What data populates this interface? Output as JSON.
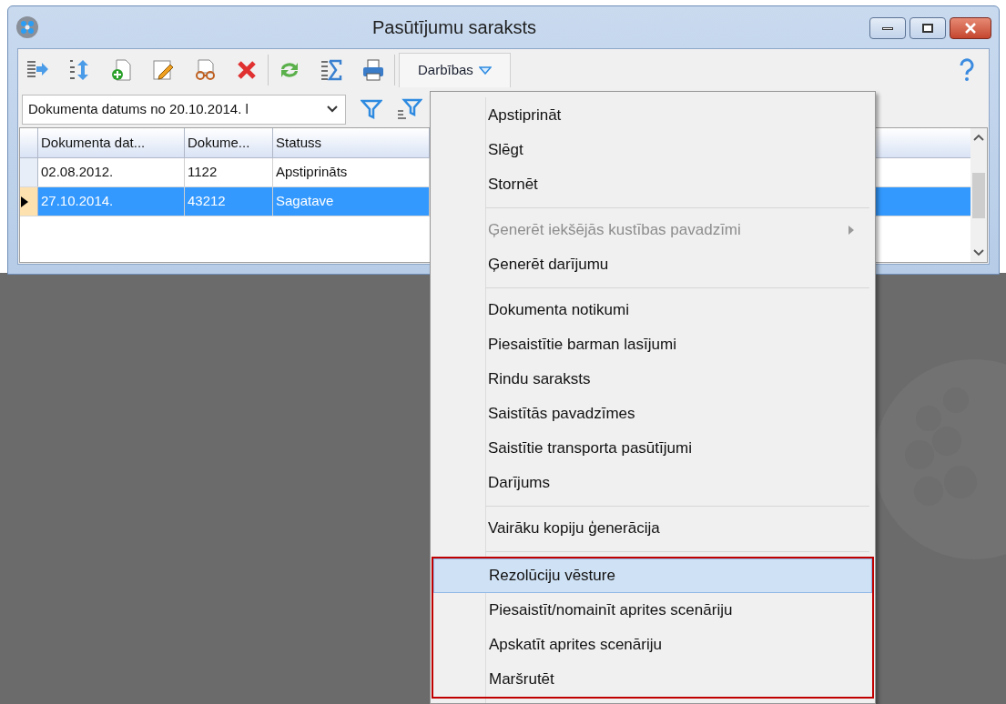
{
  "window": {
    "title": "Pasūtījumu saraksts"
  },
  "toolbar": {
    "actions_button": {
      "label": "Darbības",
      "expanded": true
    }
  },
  "filter": {
    "value": "Dokumenta datums no 20.10.2014. l"
  },
  "table": {
    "columns": [
      "Dokumenta dat...",
      "Dokume...",
      "Statuss"
    ],
    "rows": [
      {
        "cells": [
          "02.08.2012.",
          "1122",
          "Apstiprināts"
        ],
        "selected": false
      },
      {
        "cells": [
          "27.10.2014.",
          "43212",
          "Sagatave"
        ],
        "selected": true
      }
    ]
  },
  "menu": {
    "items": [
      {
        "kind": "item",
        "label": "Apstiprināt",
        "disabled": false,
        "selected": false,
        "submenu": false,
        "outlined": false
      },
      {
        "kind": "item",
        "label": "Slēgt",
        "disabled": false,
        "selected": false,
        "submenu": false,
        "outlined": false
      },
      {
        "kind": "item",
        "label": "Stornēt",
        "disabled": false,
        "selected": false,
        "submenu": false,
        "outlined": false
      },
      {
        "kind": "separator"
      },
      {
        "kind": "item",
        "label": "Ģenerēt iekšējās kustības pavadzīmi",
        "disabled": true,
        "selected": false,
        "submenu": true,
        "outlined": false
      },
      {
        "kind": "item",
        "label": "Ģenerēt darījumu",
        "disabled": false,
        "selected": false,
        "submenu": false,
        "outlined": false
      },
      {
        "kind": "separator"
      },
      {
        "kind": "item",
        "label": "Dokumenta notikumi",
        "disabled": false,
        "selected": false,
        "submenu": false,
        "outlined": false
      },
      {
        "kind": "item",
        "label": "Piesaistītie barman lasījumi",
        "disabled": false,
        "selected": false,
        "submenu": false,
        "outlined": false
      },
      {
        "kind": "item",
        "label": "Rindu saraksts",
        "disabled": false,
        "selected": false,
        "submenu": false,
        "outlined": false
      },
      {
        "kind": "item",
        "label": "Saistītās pavadzīmes",
        "disabled": false,
        "selected": false,
        "submenu": false,
        "outlined": false
      },
      {
        "kind": "item",
        "label": "Saistītie transporta pasūtījumi",
        "disabled": false,
        "selected": false,
        "submenu": false,
        "outlined": false
      },
      {
        "kind": "item",
        "label": "Darījums",
        "disabled": false,
        "selected": false,
        "submenu": false,
        "outlined": false
      },
      {
        "kind": "separator"
      },
      {
        "kind": "item",
        "label": "Vairāku kopiju ģenerācija",
        "disabled": false,
        "selected": false,
        "submenu": false,
        "outlined": false
      },
      {
        "kind": "separator"
      },
      {
        "kind": "item",
        "label": "Rezolūciju vēsture",
        "disabled": false,
        "selected": true,
        "submenu": false,
        "outlined": true
      },
      {
        "kind": "item",
        "label": "Piesaistīt/nomainīt aprites scenāriju",
        "disabled": false,
        "selected": false,
        "submenu": false,
        "outlined": true
      },
      {
        "kind": "item",
        "label": "Apskatīt aprites scenāriju",
        "disabled": false,
        "selected": false,
        "submenu": false,
        "outlined": true
      },
      {
        "kind": "item",
        "label": "Maršrutēt",
        "disabled": false,
        "selected": false,
        "submenu": false,
        "outlined": true
      }
    ]
  }
}
